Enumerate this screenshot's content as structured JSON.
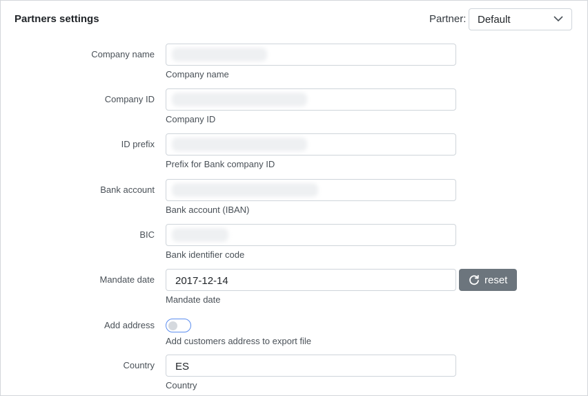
{
  "header": {
    "title": "Partners settings",
    "partner_label": "Partner:",
    "partner_value": "Default"
  },
  "fields": {
    "company_name": {
      "label": "Company name",
      "value": "",
      "help": "Company name"
    },
    "company_id": {
      "label": "Company ID",
      "value": "",
      "help": "Company ID"
    },
    "id_prefix": {
      "label": "ID prefix",
      "value": "",
      "help": "Prefix for Bank company ID"
    },
    "bank_account": {
      "label": "Bank account",
      "value": "",
      "help": "Bank account (IBAN)"
    },
    "bic": {
      "label": "BIC",
      "value": "",
      "help": "Bank identifier code"
    },
    "mandate_date": {
      "label": "Mandate date",
      "value": "2017-12-14",
      "help": "Mandate date",
      "reset_label": "reset"
    },
    "add_address": {
      "label": "Add address",
      "enabled": false,
      "help": "Add customers address to export file"
    },
    "country": {
      "label": "Country",
      "value": "ES",
      "help": "Country"
    }
  },
  "colors": {
    "accent": "#5b8def",
    "reset_bg": "#6c757d",
    "border": "#ced4da"
  },
  "icons": {
    "select_chevron": "chevron-down-icon",
    "reset": "refresh-icon"
  }
}
